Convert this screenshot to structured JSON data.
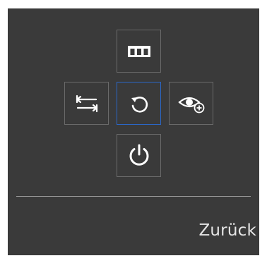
{
  "osd": {
    "back_label": "Zurück",
    "buttons": [
      {
        "icon": "picture-bars-icon",
        "selected": false
      },
      {
        "icon": "source-switch-icon",
        "selected": false
      },
      {
        "icon": "return-icon",
        "selected": true
      },
      {
        "icon": "eye-saver-icon",
        "selected": false
      },
      {
        "icon": "power-icon",
        "selected": false
      }
    ]
  },
  "colors": {
    "panel_bg": "#3a3a3a",
    "button_border": "#6a6a6a",
    "selected_border": "#2b67c7",
    "icon": "#ffffff",
    "divider": "#9a9a9a",
    "text": "#e6e6e6"
  }
}
